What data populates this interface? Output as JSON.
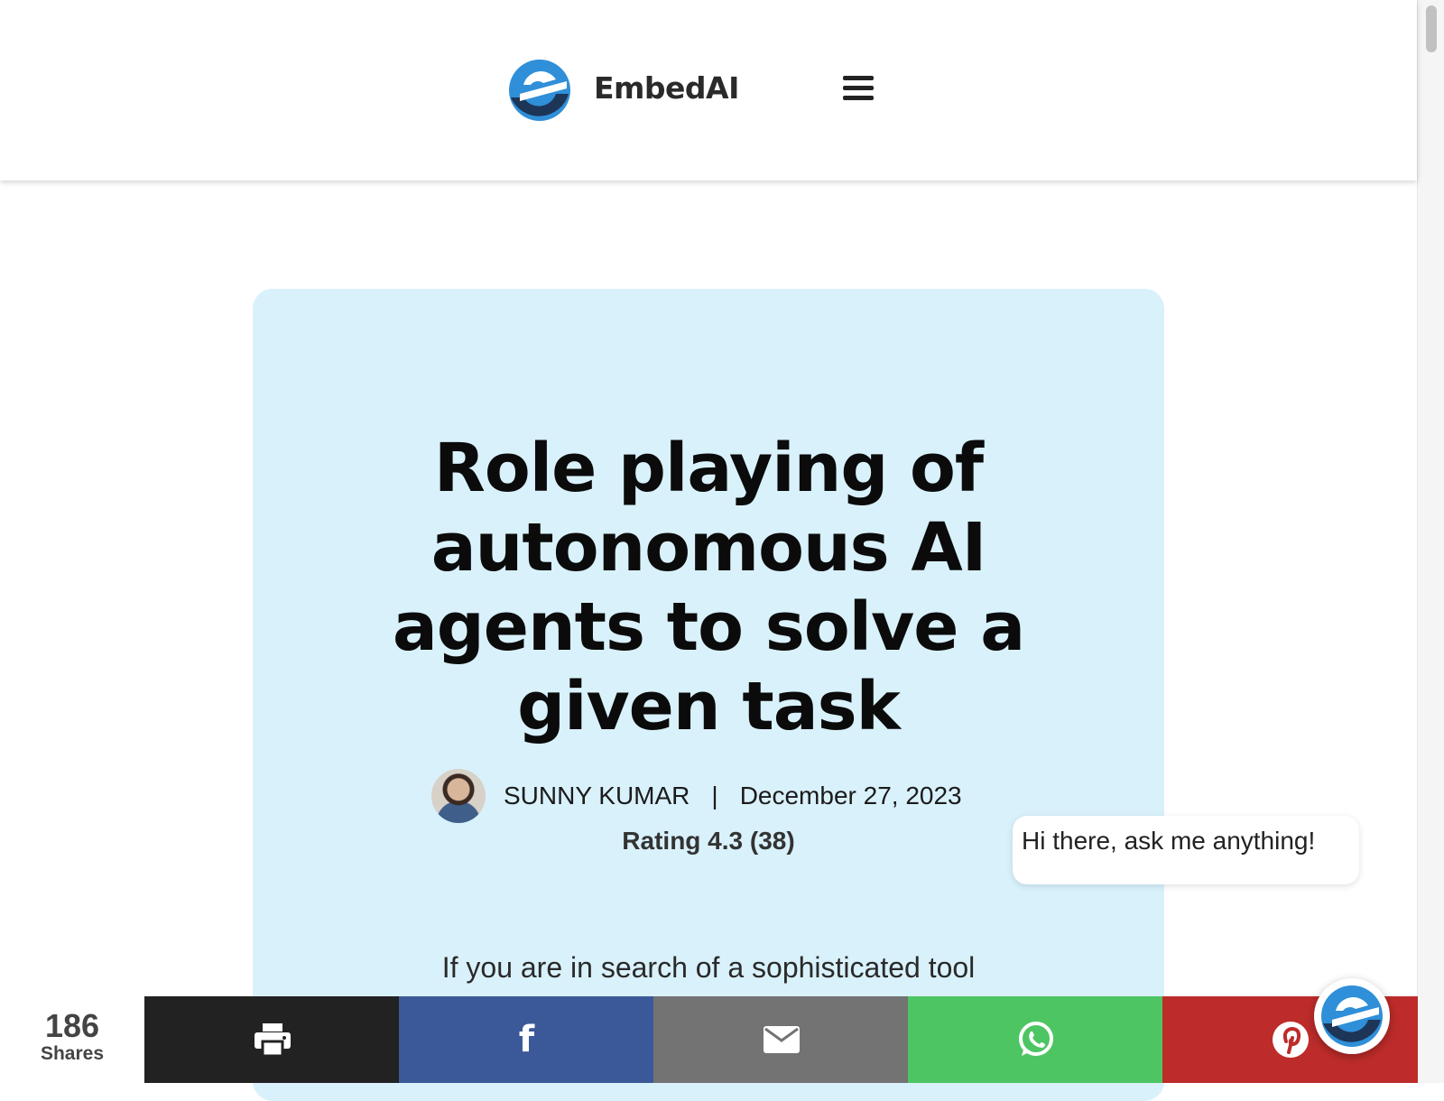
{
  "header": {
    "brand": "EmbedAI",
    "logo_icon": "embedai-logo-icon",
    "menu_icon": "hamburger-menu-icon"
  },
  "article": {
    "title": "Role playing of autonomous AI agents to solve a given task",
    "author": "SUNNY KUMAR",
    "separator": "|",
    "date": "December 27, 2023",
    "rating": "Rating 4.3 (38)",
    "intro": "If you are in search of a sophisticated tool"
  },
  "chat": {
    "bubble_text": "Hi there, ask me anything!",
    "launcher_icon": "embedai-chat-icon"
  },
  "share": {
    "count": "186",
    "label": "Shares",
    "buttons": [
      {
        "icon": "print-icon",
        "color": "#222222"
      },
      {
        "icon": "facebook-icon",
        "glyph": "f",
        "color": "#3b5998"
      },
      {
        "icon": "email-icon",
        "color": "#737373"
      },
      {
        "icon": "whatsapp-icon",
        "color": "#4ec563"
      },
      {
        "icon": "pinterest-icon",
        "color": "#bd2c2a"
      }
    ]
  },
  "colors": {
    "card_background": "#d9f1fb",
    "brand_blue": "#2f8fd8",
    "brand_navy": "#1d3557"
  }
}
